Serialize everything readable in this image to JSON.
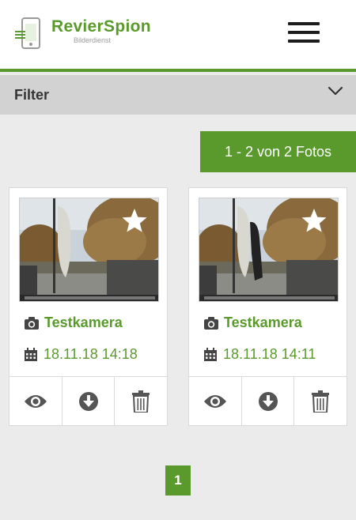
{
  "header": {
    "logo_title": "RevierSpion",
    "logo_subtitle": "Bilderdienst"
  },
  "filter": {
    "label": "Filter"
  },
  "results": {
    "count_label": "1 - 2 von 2 Fotos"
  },
  "photos": [
    {
      "camera": "Testkamera",
      "datetime": "18.11.18 14:18"
    },
    {
      "camera": "Testkamera",
      "datetime": "18.11.18 14:11"
    }
  ],
  "pagination": {
    "current": "1"
  },
  "icons": {
    "menu": "hamburger-menu-icon",
    "filter": "chevron-down-icon",
    "favorite": "star-icon",
    "camera": "camera-icon",
    "date": "calendar-icon",
    "view": "eye-icon",
    "download": "download-icon",
    "delete": "trash-icon"
  },
  "colors": {
    "brand": "#5a9a2c",
    "filter_bar": "#d2d2d2",
    "background": "#ebebeb"
  }
}
